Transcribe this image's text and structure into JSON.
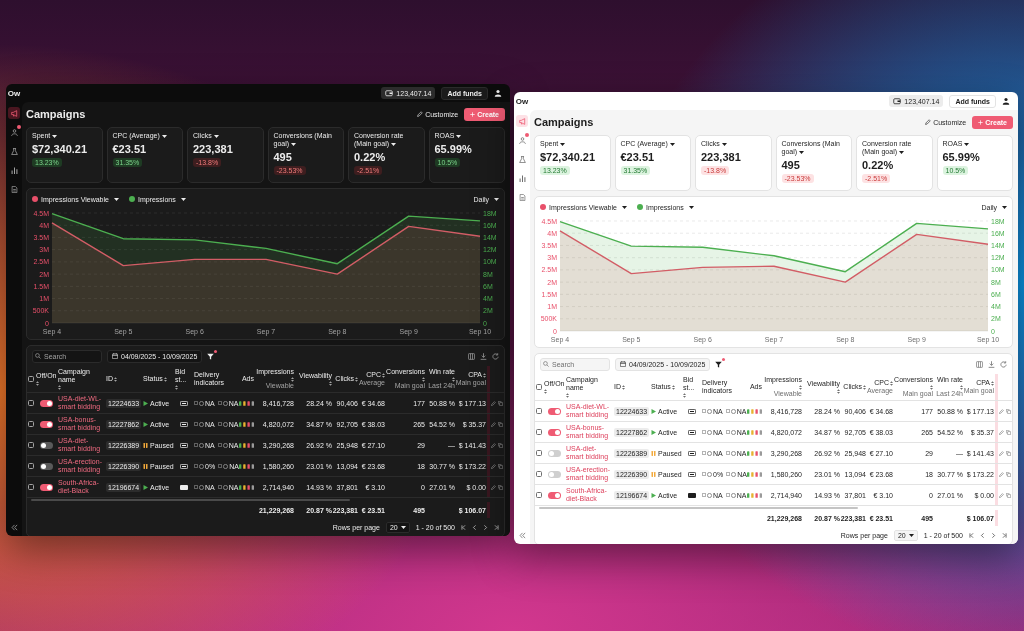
{
  "windows": [
    {
      "kind": "dark",
      "logo": "Ow",
      "sidebar": [
        {
          "kind": "campaigns",
          "selected": true,
          "badge": false
        },
        {
          "kind": "audience",
          "selected": false,
          "badge": true
        },
        {
          "kind": "tools",
          "selected": false,
          "badge": false
        },
        {
          "kind": "analytics",
          "selected": false,
          "badge": false
        },
        {
          "kind": "billing",
          "selected": false,
          "badge": false
        }
      ],
      "top_bar": {
        "balance": "123,407.14",
        "add_funds": "Add funds"
      },
      "page": {
        "title": "Campaigns",
        "customize": "Customize",
        "create": "Create"
      },
      "metrics": [
        {
          "label": "Spent",
          "value": "$72,340.21",
          "change": "13.23%",
          "positive": true
        },
        {
          "label": "CPC (Average)",
          "value": "€23.51",
          "change": "31.35%",
          "positive": true
        },
        {
          "label": "Clicks",
          "value": "223,381",
          "change": "-13.8%",
          "positive": false
        },
        {
          "label": "Conversions (Main goal)",
          "value": "495",
          "change": "-23.53%",
          "positive": false
        },
        {
          "label": "Conversion rate (Main goal)",
          "value": "0.22%",
          "change": "-2.51%",
          "positive": false
        },
        {
          "label": "ROAS",
          "value": "65.99%",
          "change": "10.5%",
          "positive": true
        }
      ],
      "chart": {
        "period": "Daily",
        "chart_data": {
          "type": "area",
          "grid": true,
          "categories": [
            "Sep 4",
            "Sep 5",
            "Sep 6",
            "Sep 7",
            "Sep 8",
            "Sep 9",
            "Sep 10"
          ],
          "series": [
            {
              "name": "Impressions Viewable",
              "color": "#e8506a",
              "values": [
                4100000,
                2350000,
                2600000,
                2600000,
                2000000,
                3950000,
                3550000
              ]
            },
            {
              "name": "Impressions",
              "color": "#4caf50",
              "axis": "y2",
              "values": [
                17900000,
                13800000,
                13600000,
                12200000,
                9700000,
                17500000,
                16700000
              ]
            }
          ],
          "ylim": [
            0,
            4500000
          ],
          "yticks": [
            {
              "value": 0,
              "label": "0"
            },
            {
              "value": 500000,
              "label": "500K"
            },
            {
              "value": 1000000,
              "label": "1M"
            },
            {
              "value": 1500000,
              "label": "1.5M"
            },
            {
              "value": 2000000,
              "label": "2M"
            },
            {
              "value": 2500000,
              "label": "2.5M"
            },
            {
              "value": 3000000,
              "label": "3M"
            },
            {
              "value": 3500000,
              "label": "3.5M"
            },
            {
              "value": 4000000,
              "label": "4M"
            },
            {
              "value": 4500000,
              "label": "4.5M"
            }
          ],
          "y2lim": [
            0,
            18000000
          ],
          "y2ticks": [
            {
              "value": 0,
              "label": "0"
            },
            {
              "value": 2000000,
              "label": "2M"
            },
            {
              "value": 4000000,
              "label": "4M"
            },
            {
              "value": 6000000,
              "label": "6M"
            },
            {
              "value": 8000000,
              "label": "8M"
            },
            {
              "value": 10000000,
              "label": "10M"
            },
            {
              "value": 12000000,
              "label": "12M"
            },
            {
              "value": 14000000,
              "label": "14M"
            },
            {
              "value": 16000000,
              "label": "16M"
            },
            {
              "value": 18000000,
              "label": "18M"
            }
          ]
        }
      },
      "table": {
        "search_placeholder": "Search",
        "date_range": "04/09/2025 - 10/09/2025",
        "filter_active": true,
        "header_checked": false,
        "columns": [
          {
            "label": "Off/On",
            "sortable": true
          },
          {
            "label": "Campaign name",
            "sortable": true
          },
          {
            "label": "ID",
            "sortable": true
          },
          {
            "label": "Status",
            "sortable": true
          },
          {
            "label": "Bid st...",
            "sortable": true
          },
          {
            "label": "Delivery indicators",
            "sortable": false
          },
          {
            "label": "Ads",
            "sortable": false
          },
          {
            "label": "Impressions",
            "sublabel": "Viewable",
            "sortable": true
          },
          {
            "label": "Viewability",
            "sortable": true
          },
          {
            "label": "Clicks",
            "sortable": true
          },
          {
            "label": "CPC",
            "sublabel": "Average",
            "sortable": true
          },
          {
            "label": "Conversions",
            "sublabel": "Main goal",
            "sortable": true
          },
          {
            "label": "Win rate",
            "sublabel": "Last 24h",
            "sortable": true
          },
          {
            "label": "CPA",
            "sublabel": "Main goal",
            "sortable": true
          }
        ],
        "rows": [
          {
            "checked": false,
            "on": true,
            "name": "USA-diet-WL-smart bidding",
            "id": "12224633",
            "status": {
              "kind": "active",
              "label": "Active"
            },
            "bid": {
              "kind": "dash"
            },
            "delivery": [
              "NA",
              "NA"
            ],
            "impressions": "8,416,728",
            "viewability": "28.24 %",
            "clicks": "90,406",
            "cpc": "€ 34.68",
            "conversions": "177",
            "win_rate": "50.88 %",
            "cpa": "$ 177.13"
          },
          {
            "checked": false,
            "on": true,
            "name": "USA-bonus-smart bidding",
            "id": "12227862",
            "status": {
              "kind": "active",
              "label": "Active"
            },
            "bid": {
              "kind": "dash"
            },
            "delivery": [
              "NA",
              "NA"
            ],
            "impressions": "4,820,072",
            "viewability": "34.87 %",
            "clicks": "92,705",
            "cpc": "€ 38.03",
            "conversions": "265",
            "win_rate": "54.52 %",
            "cpa": "$ 35.37"
          },
          {
            "checked": false,
            "on": false,
            "name": "USA-diet-smart bidding",
            "id": "12226389",
            "status": {
              "kind": "paused",
              "label": "Paused"
            },
            "bid": {
              "kind": "dash"
            },
            "delivery": [
              "NA",
              "NA"
            ],
            "impressions": "3,290,268",
            "viewability": "26.92 %",
            "clicks": "25,948",
            "cpc": "€ 27.10",
            "conversions": "29",
            "win_rate": "—",
            "cpa": "$ 141.43"
          },
          {
            "checked": false,
            "on": false,
            "name": "USA-erection-smart bidding",
            "id": "12226390",
            "status": {
              "kind": "paused",
              "label": "Paused"
            },
            "bid": {
              "kind": "dash"
            },
            "delivery": [
              "0%",
              "NA"
            ],
            "impressions": "1,580,260",
            "viewability": "23.01 %",
            "clicks": "13,094",
            "cpc": "€ 23.68",
            "conversions": "18",
            "win_rate": "30.77 %",
            "cpa": "$ 173.22"
          },
          {
            "checked": false,
            "on": true,
            "name": "South-Africa-diet-Black",
            "id": "12196674",
            "status": {
              "kind": "active",
              "label": "Active"
            },
            "bid": {
              "kind": "square"
            },
            "delivery": [
              "NA",
              "NA"
            ],
            "impressions": "2,714,940",
            "viewability": "14.93 %",
            "clicks": "37,801",
            "cpc": "€ 3.10",
            "conversions": "0",
            "win_rate": "27.01 %",
            "cpa": "$ 0.00"
          }
        ],
        "totals": {
          "impressions": "21,229,268",
          "viewability": "20.87 %",
          "clicks": "223,381",
          "cpc": "€ 23.51",
          "conversions": "495",
          "cpa": "$ 106.07"
        },
        "pagination": {
          "rows_per_page_label": "Rows per page",
          "rows_per_page": "20",
          "range": "1 - 20 of 500"
        }
      }
    },
    {
      "kind": "light",
      "logo": "Ow",
      "sidebar": [
        {
          "kind": "campaigns",
          "selected": true,
          "badge": false
        },
        {
          "kind": "audience",
          "selected": false,
          "badge": true
        },
        {
          "kind": "tools",
          "selected": false,
          "badge": false
        },
        {
          "kind": "analytics",
          "selected": false,
          "badge": false
        },
        {
          "kind": "billing",
          "selected": false,
          "badge": false
        }
      ],
      "top_bar": {
        "balance": "123,407.14",
        "add_funds": "Add funds"
      },
      "page": {
        "title": "Campaigns",
        "customize": "Customize",
        "create": "Create"
      },
      "metrics": [
        {
          "label": "Spent",
          "value": "$72,340.21",
          "change": "13.23%",
          "positive": true
        },
        {
          "label": "CPC (Average)",
          "value": "€23.51",
          "change": "31.35%",
          "positive": true
        },
        {
          "label": "Clicks",
          "value": "223,381",
          "change": "-13.8%",
          "positive": false
        },
        {
          "label": "Conversions (Main goal)",
          "value": "495",
          "change": "-23.53%",
          "positive": false
        },
        {
          "label": "Conversion rate (Main goal)",
          "value": "0.22%",
          "change": "-2.51%",
          "positive": false
        },
        {
          "label": "ROAS",
          "value": "65.99%",
          "change": "10.5%",
          "positive": true
        }
      ],
      "chart": {
        "period": "Daily",
        "chart_data": {
          "type": "area",
          "grid": true,
          "categories": [
            "Sep 4",
            "Sep 5",
            "Sep 6",
            "Sep 7",
            "Sep 8",
            "Sep 9",
            "Sep 10"
          ],
          "series": [
            {
              "name": "Impressions Viewable",
              "color": "#e8506a",
              "values": [
                4100000,
                2350000,
                2600000,
                2650000,
                2000000,
                3950000,
                3550000
              ]
            },
            {
              "name": "Impressions",
              "color": "#4caf50",
              "axis": "y2",
              "values": [
                17900000,
                13900000,
                13700000,
                12300000,
                9700000,
                17600000,
                16700000
              ]
            }
          ],
          "ylim": [
            0,
            4500000
          ],
          "yticks": [
            {
              "value": 0,
              "label": "0"
            },
            {
              "value": 500000,
              "label": "500K"
            },
            {
              "value": 1000000,
              "label": "1M"
            },
            {
              "value": 1500000,
              "label": "1.5M"
            },
            {
              "value": 2000000,
              "label": "2M"
            },
            {
              "value": 2500000,
              "label": "2.5M"
            },
            {
              "value": 3000000,
              "label": "3M"
            },
            {
              "value": 3500000,
              "label": "3.5M"
            },
            {
              "value": 4000000,
              "label": "4M"
            },
            {
              "value": 4500000,
              "label": "4.5M"
            }
          ],
          "y2lim": [
            0,
            18000000
          ],
          "y2ticks": [
            {
              "value": 0,
              "label": "0"
            },
            {
              "value": 2000000,
              "label": "2M"
            },
            {
              "value": 4000000,
              "label": "4M"
            },
            {
              "value": 6000000,
              "label": "6M"
            },
            {
              "value": 8000000,
              "label": "8M"
            },
            {
              "value": 10000000,
              "label": "10M"
            },
            {
              "value": 12000000,
              "label": "12M"
            },
            {
              "value": 14000000,
              "label": "14M"
            },
            {
              "value": 16000000,
              "label": "16M"
            },
            {
              "value": 18000000,
              "label": "18M"
            }
          ]
        }
      },
      "table": {
        "search_placeholder": "Search",
        "date_range": "04/09/2025 - 10/09/2025",
        "filter_active": true,
        "header_checked": false,
        "columns": [
          {
            "label": "Off/On",
            "sortable": true
          },
          {
            "label": "Campaign name",
            "sortable": true
          },
          {
            "label": "ID",
            "sortable": true
          },
          {
            "label": "Status",
            "sortable": true
          },
          {
            "label": "Bid st...",
            "sortable": true
          },
          {
            "label": "Delivery indicators",
            "sortable": false
          },
          {
            "label": "Ads",
            "sortable": false
          },
          {
            "label": "Impressions",
            "sublabel": "Viewable",
            "sortable": true
          },
          {
            "label": "Viewability",
            "sortable": true
          },
          {
            "label": "Clicks",
            "sortable": true
          },
          {
            "label": "CPC",
            "sublabel": "Average",
            "sortable": true
          },
          {
            "label": "Conversions",
            "sublabel": "Main goal",
            "sortable": true
          },
          {
            "label": "Win rate",
            "sublabel": "Last 24h",
            "sortable": true
          },
          {
            "label": "CPA",
            "sublabel": "Main goal",
            "sortable": true
          }
        ],
        "rows": [
          {
            "checked": false,
            "on": true,
            "name": "USA-diet-WL-smart bidding",
            "id": "12224633",
            "status": {
              "kind": "active",
              "label": "Active"
            },
            "bid": {
              "kind": "dash"
            },
            "delivery": [
              "NA",
              "NA"
            ],
            "impressions": "8,416,728",
            "viewability": "28.24 %",
            "clicks": "90,406",
            "cpc": "€ 34.68",
            "conversions": "177",
            "win_rate": "50.88 %",
            "cpa": "$ 177.13"
          },
          {
            "checked": false,
            "on": true,
            "name": "USA-bonus-smart bidding",
            "id": "12227862",
            "status": {
              "kind": "active",
              "label": "Active"
            },
            "bid": {
              "kind": "dash"
            },
            "delivery": [
              "NA",
              "NA"
            ],
            "impressions": "4,820,072",
            "viewability": "34.87 %",
            "clicks": "92,705",
            "cpc": "€ 38.03",
            "conversions": "265",
            "win_rate": "54.52 %",
            "cpa": "$ 35.37"
          },
          {
            "checked": false,
            "on": false,
            "name": "USA-diet-smart bidding",
            "id": "12226389",
            "status": {
              "kind": "paused",
              "label": "Paused"
            },
            "bid": {
              "kind": "dash"
            },
            "delivery": [
              "NA",
              "NA"
            ],
            "impressions": "3,290,268",
            "viewability": "26.92 %",
            "clicks": "25,948",
            "cpc": "€ 27.10",
            "conversions": "29",
            "win_rate": "—",
            "cpa": "$ 141.43"
          },
          {
            "checked": false,
            "on": false,
            "name": "USA-erection-smart bidding",
            "id": "12226390",
            "status": {
              "kind": "paused",
              "label": "Paused"
            },
            "bid": {
              "kind": "dash"
            },
            "delivery": [
              "0%",
              "NA"
            ],
            "impressions": "1,580,260",
            "viewability": "23.01 %",
            "clicks": "13,094",
            "cpc": "€ 23.68",
            "conversions": "18",
            "win_rate": "30.77 %",
            "cpa": "$ 173.22"
          },
          {
            "checked": false,
            "on": true,
            "name": "South-Africa-diet-Black",
            "id": "12196674",
            "status": {
              "kind": "active",
              "label": "Active"
            },
            "bid": {
              "kind": "square"
            },
            "delivery": [
              "NA",
              "NA"
            ],
            "impressions": "2,714,940",
            "viewability": "14.93 %",
            "clicks": "37,801",
            "cpc": "€ 3.10",
            "conversions": "0",
            "win_rate": "27.01 %",
            "cpa": "$ 0.00"
          }
        ],
        "totals": {
          "impressions": "21,229,268",
          "viewability": "20.87 %",
          "clicks": "223,381",
          "cpc": "€ 23.51",
          "conversions": "495",
          "cpa": "$ 106.07"
        },
        "pagination": {
          "rows_per_page_label": "Rows per page",
          "rows_per_page": "20",
          "range": "1 - 20 of 500"
        }
      }
    }
  ]
}
